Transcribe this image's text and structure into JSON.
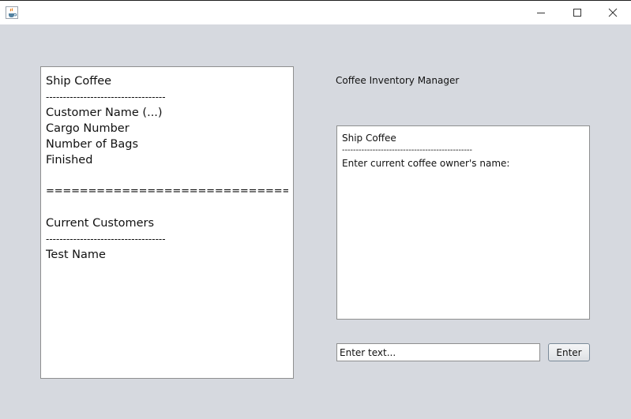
{
  "window": {
    "app_icon": "java-cup-icon",
    "controls": {
      "minimize": "minimize-icon",
      "maximize": "maximize-icon",
      "close": "close-icon"
    }
  },
  "app_title": "Coffee Inventory Manager",
  "menu_panel": {
    "lines": [
      "Ship Coffee",
      "-----------------------------------",
      "Customer Name (...)",
      "Cargo Number",
      "Number of Bags",
      "Finished",
      "",
      "=================================",
      "",
      "Current Customers",
      "-----------------------------------",
      "Test Name"
    ]
  },
  "output_panel": {
    "lines": [
      "Ship Coffee",
      "-----------------------------------------------",
      "Enter current coffee owner's name:"
    ]
  },
  "input": {
    "value": "Enter text..."
  },
  "enter_button": {
    "label": "Enter"
  }
}
